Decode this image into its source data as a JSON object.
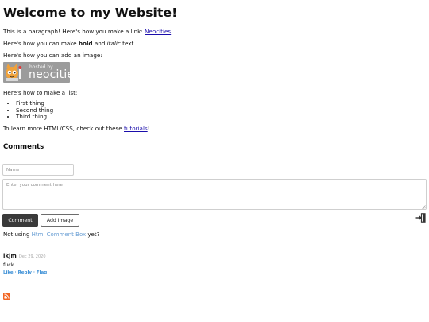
{
  "heading": "Welcome to my Website!",
  "intro": {
    "p1_before": "This is a paragraph! Here's how you make a link: ",
    "p1_link": "Neocities",
    "p1_after": ".",
    "p2_before": "Here's how you can make ",
    "p2_bold": "bold",
    "p2_mid": " and ",
    "p2_italic": "italic",
    "p2_after": " text.",
    "p3": "Here's how you can add an image:"
  },
  "badge": {
    "small_text": "hosted by",
    "big_text": "neocities"
  },
  "list_intro": "Here's how to make a list:",
  "list_items": [
    "First thing",
    "Second thing",
    "Third thing"
  ],
  "outro": {
    "before": "To learn more HTML/CSS, check out these ",
    "link": "tutorials",
    "after": "!"
  },
  "comments": {
    "title": "Comments",
    "name_placeholder": "Name",
    "comment_placeholder": "Enter your comment here",
    "comment_button": "Comment",
    "add_image_button": "Add Image",
    "promo_before": "Not using ",
    "promo_link": "Html Comment Box",
    "promo_after": "  yet?",
    "entries": [
      {
        "author": "lkjm",
        "date": "Dec 29, 2020",
        "text": "fuck",
        "actions": [
          "Like",
          "Reply",
          "Flag"
        ]
      }
    ]
  },
  "colors": {
    "link": "#1a0dab",
    "button_dark": "#3a3a3a",
    "action_blue": "#3b8fd6",
    "rss_orange": "#f26522"
  },
  "icons": [
    "login-icon",
    "rss-icon",
    "neocities-cat-logo"
  ]
}
